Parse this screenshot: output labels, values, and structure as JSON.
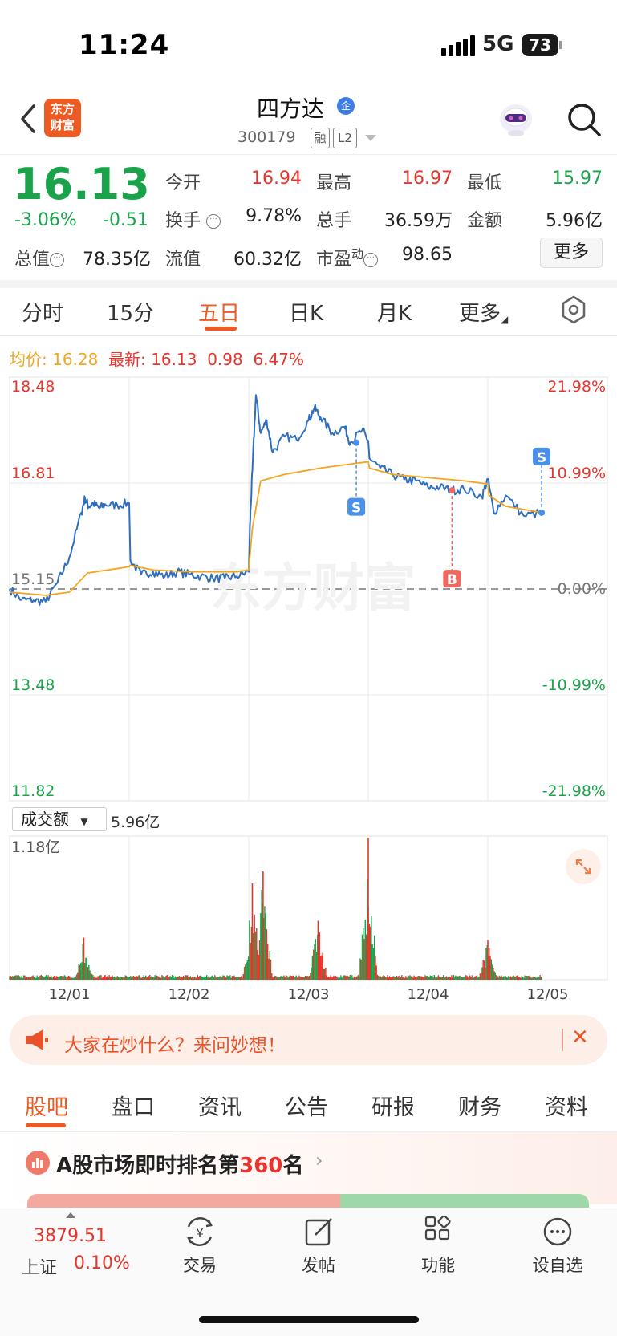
{
  "status_bar": {
    "time": "11:24",
    "network": "5G",
    "battery": "73"
  },
  "header": {
    "logo_line1": "东方",
    "logo_line2": "财富",
    "stock_name": "四方达",
    "enterprise_badge": "企",
    "stock_code": "300179",
    "tag_margin": "融",
    "tag_level": "L2",
    "icons": {
      "back": "chevron-left-icon",
      "search": "search-icon",
      "assistant": "robot-assistant-icon"
    }
  },
  "quote": {
    "price": "16.13",
    "change_pct": "-3.06%",
    "change": "-0.51",
    "open_label": "今开",
    "open": "16.94",
    "high_label": "最高",
    "high": "16.97",
    "low_label": "最低",
    "low": "15.97",
    "turnover_label": "换手",
    "turnover": "9.78%",
    "volume_label": "总手",
    "volume": "36.59万",
    "amount_label": "金额",
    "amount": "5.96亿",
    "mcap_label": "总值",
    "mcap": "78.35亿",
    "float_label": "流值",
    "float_cap": "60.32亿",
    "pe_label": "市盈",
    "pe_sup": "动",
    "pe": "98.65",
    "more_label": "更多"
  },
  "period_tabs": [
    {
      "label": "分时"
    },
    {
      "label": "15分"
    },
    {
      "label": "五日",
      "active": true
    },
    {
      "label": "日K"
    },
    {
      "label": "月K"
    },
    {
      "label": "更多"
    }
  ],
  "legend": {
    "avg_label": "均价:",
    "avg_value": "16.28",
    "latest_label": "最新:",
    "latest_value": "16.13",
    "latest_change": "0.98",
    "latest_pct": "6.47%"
  },
  "chart_data": {
    "type": "line",
    "title": "",
    "x_ticks": [
      "12/01",
      "12/02",
      "12/03",
      "12/04",
      "12/05"
    ],
    "y_ticks_left": [
      "18.48",
      "16.81",
      "15.15",
      "13.48",
      "11.82"
    ],
    "y_ticks_right": [
      "21.98%",
      "10.99%",
      "0.00%",
      "-10.99%",
      "-21.98%"
    ],
    "ylim": [
      11.82,
      18.48
    ],
    "baseline": 15.15,
    "series": [
      {
        "name": "价格",
        "color": "#2f6fbf",
        "x": [
          0,
          0.1,
          0.2,
          0.3,
          0.4,
          0.5,
          0.6,
          0.63,
          0.66,
          0.7,
          0.75,
          0.8,
          0.9,
          1.0,
          1.01,
          1.1,
          1.2,
          1.3,
          1.4,
          1.5,
          1.6,
          1.7,
          1.8,
          1.9,
          2.0,
          2.01,
          2.03,
          2.06,
          2.1,
          2.15,
          2.2,
          2.3,
          2.4,
          2.5,
          2.55,
          2.6,
          2.7,
          2.8,
          2.85,
          2.95,
          3.0,
          3.01,
          3.1,
          3.2,
          3.3,
          3.4,
          3.5,
          3.6,
          3.7,
          3.8,
          3.95,
          4.0,
          4.05,
          4.15,
          4.3,
          4.45
        ],
        "y": [
          15.15,
          14.98,
          14.97,
          14.95,
          15.25,
          15.65,
          16.35,
          16.58,
          16.45,
          16.5,
          16.42,
          16.48,
          16.47,
          16.5,
          15.6,
          15.38,
          15.42,
          15.35,
          15.42,
          15.38,
          15.35,
          15.32,
          15.32,
          15.35,
          15.42,
          16.15,
          17.0,
          18.2,
          17.6,
          17.8,
          17.3,
          17.55,
          17.5,
          17.8,
          18.0,
          17.85,
          17.6,
          17.7,
          17.45,
          17.65,
          17.48,
          17.2,
          17.05,
          16.95,
          16.87,
          16.85,
          16.75,
          16.75,
          16.7,
          16.72,
          16.6,
          16.88,
          16.35,
          16.62,
          16.3,
          16.35
        ]
      },
      {
        "name": "均价",
        "color": "#f3a61b",
        "x": [
          0,
          0.3,
          0.5,
          0.65,
          1.0,
          1.01,
          1.2,
          1.5,
          1.9,
          2.0,
          2.03,
          2.1,
          2.3,
          2.6,
          2.8,
          3.0,
          3.01,
          3.2,
          3.5,
          3.8,
          4.0,
          4.01,
          4.15,
          4.45
        ],
        "y": [
          15.1,
          15.05,
          15.1,
          15.4,
          15.5,
          15.52,
          15.45,
          15.42,
          15.42,
          15.45,
          16.1,
          16.85,
          16.95,
          17.05,
          17.1,
          17.15,
          17.05,
          16.95,
          16.9,
          16.85,
          16.8,
          16.62,
          16.45,
          16.35
        ]
      }
    ],
    "trade_markers": [
      {
        "label": "S",
        "x": 2.9,
        "y": 17.45
      },
      {
        "label": "B",
        "x": 3.7,
        "y": 16.7
      },
      {
        "label": "S",
        "x": 4.45,
        "y": 16.35
      }
    ],
    "watermark": "东方财富"
  },
  "volume": {
    "selector_label": "成交额",
    "total": "5.96亿",
    "max_label": "1.18亿",
    "ylim": [
      0,
      1.18
    ],
    "unit": "亿",
    "peaks": [
      {
        "x": 0.62,
        "value": 0.35
      },
      {
        "x": 2.03,
        "value": 0.8
      },
      {
        "x": 2.12,
        "value": 0.9
      },
      {
        "x": 2.58,
        "value": 0.49
      },
      {
        "x": 3.0,
        "value": 1.18
      },
      {
        "x": 4.0,
        "value": 0.33
      }
    ]
  },
  "banner": {
    "text": "大家在炒什么？来问妙想！",
    "close": "✕",
    "icon": "megaphone-icon"
  },
  "section_tabs": [
    {
      "label": "股吧",
      "active": true
    },
    {
      "label": "盘口"
    },
    {
      "label": "资讯"
    },
    {
      "label": "公告"
    },
    {
      "label": "研报"
    },
    {
      "label": "财务"
    },
    {
      "label": "资料"
    }
  ],
  "rank": {
    "prefix": "A股市场即时排名第",
    "number": "360",
    "suffix": "名",
    "chevron": "›"
  },
  "bottom_nav": {
    "index_value": "3879.51",
    "index_name": "上证",
    "index_pct": "0.10%",
    "items": [
      {
        "label": "交易",
        "icon": "trade-yen-icon"
      },
      {
        "label": "发帖",
        "icon": "compose-icon"
      },
      {
        "label": "功能",
        "icon": "apps-grid-icon"
      },
      {
        "label": "设自选",
        "icon": "more-dots-icon"
      }
    ]
  }
}
